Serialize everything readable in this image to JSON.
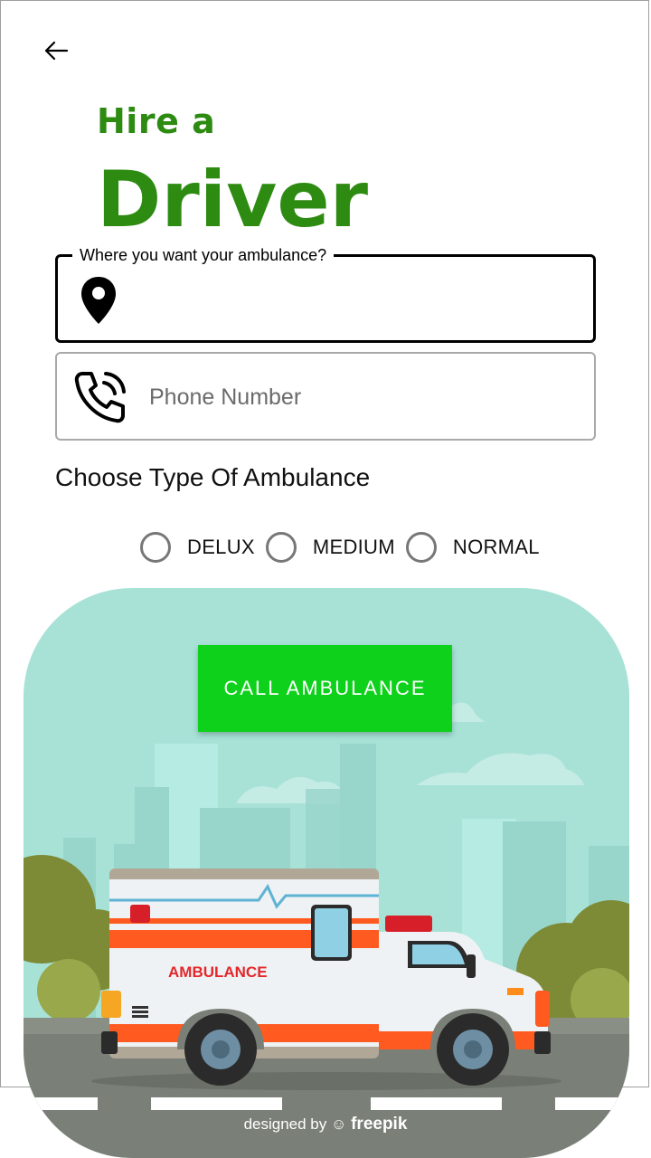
{
  "header": {
    "back_icon": "arrow-left-icon",
    "title_line1": "Hire a",
    "title_line2": "Driver"
  },
  "form": {
    "location_label": "Where you want your ambulance?",
    "location_value": "",
    "location_icon": "location-pin-icon",
    "phone_placeholder": "Phone Number",
    "phone_value": "",
    "phone_icon": "phone-call-icon"
  },
  "ambulance_type": {
    "heading": "Choose Type Of Ambulance",
    "options": [
      "DELUX",
      "MEDIUM",
      "NORMAL"
    ],
    "selected": null
  },
  "cta": {
    "label": "CALL AMBULANCE"
  },
  "illustration": {
    "vehicle_text": "AMBULANCE",
    "credit_prefix": "designed by",
    "credit_brand": "freepik"
  },
  "colors": {
    "title_green": "#2e8b12",
    "button_green": "#0dd11a",
    "sky": "#a8e2d7"
  }
}
